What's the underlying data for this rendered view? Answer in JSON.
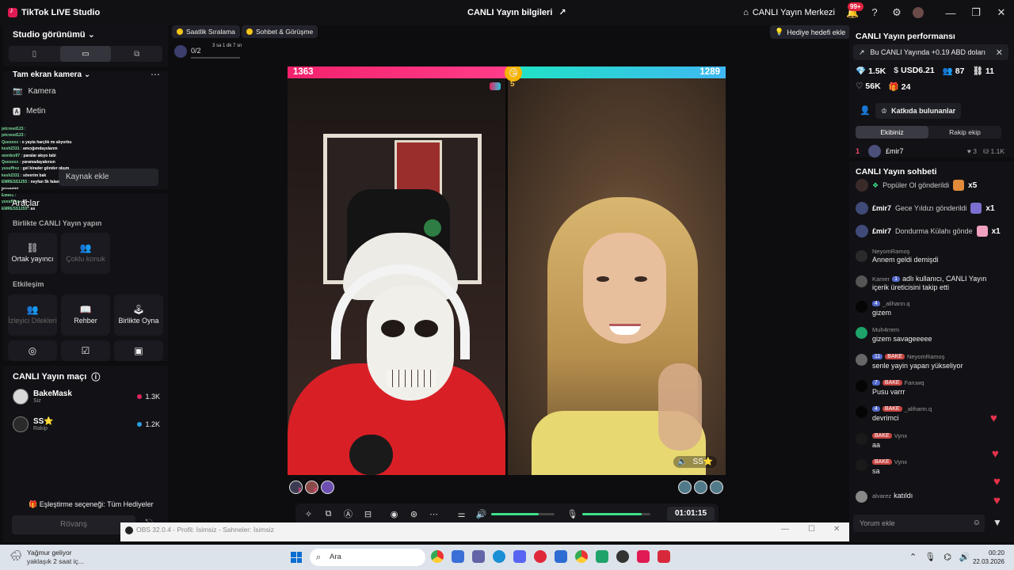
{
  "window": {
    "app_title": "TikTok LIVE Studio",
    "center_title": "CANLI Yayın bilgileri",
    "live_center": "CANLI Yayın Merkezi",
    "notif_badge": "99+"
  },
  "left": {
    "view_title": "Studio görünümü",
    "camera_title": "Tam ekran kamera",
    "sources": [
      "Kamera",
      "Metin"
    ],
    "add_source": "Kaynak ekle",
    "tools_title": "Araçlar",
    "overlay_chat": [
      {
        "u": "jetcreed123 :",
        "t": ""
      },
      {
        "u": "jetcreed123 :",
        "t": ""
      },
      {
        "u": "Quesoxx :",
        "t": "o yayta harçlık mı alıyorbu"
      },
      {
        "u": "kesh2331 :",
        "t": "amcığımdayslarım"
      },
      {
        "u": "wordex97 :",
        "t": "paralar akıyo tabi"
      },
      {
        "u": "Quesoxx :",
        "t": "yaramadayakırsın"
      },
      {
        "u": "yusuffrez :",
        "t": "gel birader gönder okum"
      },
      {
        "u": "kesh2331 :",
        "t": "söverim bak"
      },
      {
        "u": "EMRESS1255 :",
        "t": "neyfan 5k falan"
      },
      {
        "u": "",
        "t": "jesseeini"
      },
      {
        "u": "EMIR1 :",
        "t": ""
      },
      {
        "u": "yusuffrez :",
        "t": "85"
      },
      {
        "u": "EMRESS1255 :",
        "t": "as"
      }
    ],
    "together_title": "Birlikte CANLI Yayın yapın",
    "together_tiles": [
      "Ortak yayıncı",
      "Çoklu konuk"
    ],
    "interaction_title": "Etkileşim",
    "interaction_tiles": [
      "İzleyici Dilekleri",
      "Rehber",
      "Birlikte Oyna"
    ],
    "match_title": "CANLI Yayın maçı",
    "players": [
      {
        "name": "BakeMask",
        "sub": "Siz",
        "score": "1.3K",
        "color": "#e0245e"
      },
      {
        "name": "SS⭐",
        "sub": "Rakip",
        "score": "1.2K",
        "color": "#2b9fe0"
      }
    ],
    "pairing": "Eşleştirme seçeneği: Tüm Hediyeler",
    "rematch": "Rövanş"
  },
  "center": {
    "chips": [
      "Saatlik Sıralama",
      "Sohbet & Görüşme"
    ],
    "goal_value": "0/2",
    "goal_time": "3 sa 1 dk 7 sn",
    "battle": {
      "left_score": "1363",
      "right_score": "1289",
      "timer": "5",
      "opponent_tag": "SS⭐"
    },
    "left_ranks": [
      "3",
      "2",
      ""
    ],
    "stream_time": "01:01:15",
    "audio_level": 0.75,
    "mic_level": 0.87
  },
  "right": {
    "gift_goal": "Hediye hedefi ekle",
    "perf_title": "CANLI Yayın performansı",
    "earn_text": "Bu CANLI Yayında +0.19 ABD doları",
    "stats1": [
      {
        "icon": "💎",
        "v": "1.5K"
      },
      {
        "icon": "$",
        "v": "USD6.21"
      },
      {
        "icon": "👥",
        "v": "87"
      },
      {
        "icon": "⛓",
        "v": "11"
      }
    ],
    "stats2": [
      {
        "icon": "♡",
        "v": "56K"
      },
      {
        "icon": "🎁",
        "v": "24"
      }
    ],
    "contributors": "Katkıda bulunanlar",
    "team_tabs": [
      "Ekibiniz",
      "Rakip ekip"
    ],
    "top_rank": {
      "n": "1",
      "name": "£mir7",
      "likes": "3",
      "coins": "1.1K"
    },
    "chat_title": "CANLI Yayın sohbeti",
    "gifts": [
      {
        "user": "",
        "text": "Popüler Ol gönderildi",
        "mult": "x5"
      },
      {
        "user": "£mir7",
        "text": "Gece Yıldızı gönderildi",
        "mult": "x1"
      },
      {
        "user": "£mir7",
        "text": "Dondurma Külahı gönde",
        "mult": "x1"
      }
    ],
    "messages": [
      {
        "meta": "",
        "lvl": "",
        "fan": "",
        "user": "NeyomRamoş",
        "text": "Annem geldi demişdi"
      },
      {
        "meta": "Kamer",
        "lvl": "1",
        "fan": "",
        "user": "",
        "text": "adlı kullanıcı, CANLI Yayın"
      },
      {
        "meta": "",
        "lvl": "4",
        "fan": "",
        "user": "_alihann.q",
        "text": "gizem"
      },
      {
        "meta": "Muh4rrem",
        "lvl": "",
        "fan": "",
        "user": "",
        "text": "gizem savageeeee"
      },
      {
        "meta": "",
        "lvl": "11",
        "fan": "BAKE",
        "user": "NeyomRamoş",
        "text": "senle yayin yapan yükseliyor"
      },
      {
        "meta": "",
        "lvl": "7",
        "fan": "BAKE",
        "user": "Faruwq",
        "text": "Pusu varrr"
      },
      {
        "meta": "",
        "lvl": "4",
        "fan": "BAKE",
        "user": "_alihann.q",
        "text": "devrimci"
      },
      {
        "meta": "",
        "lvl": "",
        "fan": "BAKE",
        "user": "Vynx",
        "text": "aa"
      },
      {
        "meta": "",
        "lvl": "",
        "fan": "BAKE",
        "user": "Vynx",
        "text": "sa"
      }
    ],
    "follow_line2": "içerik üreticisini takip etti",
    "joined": {
      "user": "alvarez",
      "text": "katıldı"
    },
    "comment_placeholder": "Yorum ekle"
  },
  "obs": {
    "title": "OBS 32.0.4 - Profil: İsimsiz - Sahneler: İsimsiz"
  },
  "taskbar": {
    "weather_title": "Yağmur geliyor",
    "weather_sub": "yaklaşık 2 saat iç...",
    "search": "Ara",
    "time": "00:20",
    "date": "22.03.2026"
  }
}
